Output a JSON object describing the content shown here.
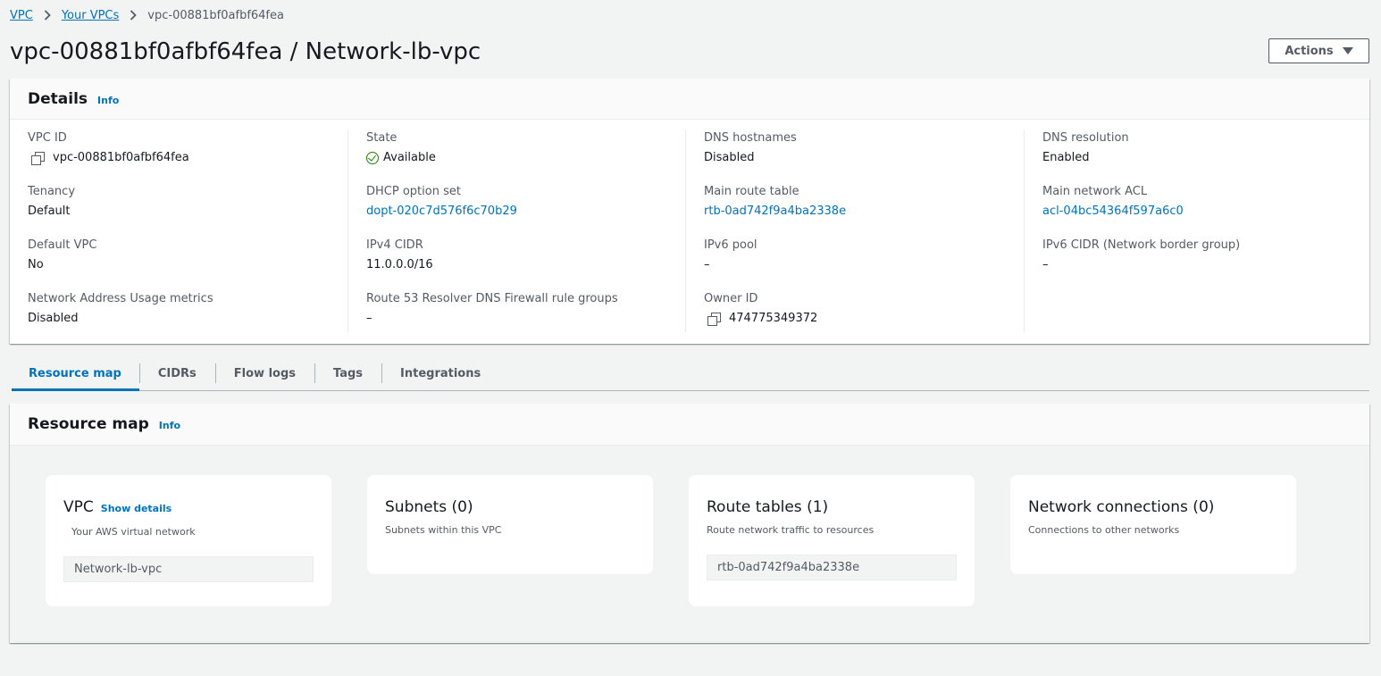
{
  "breadcrumb": {
    "items": [
      "VPC",
      "Your VPCs"
    ],
    "current": "vpc-00881bf0afbf64fea"
  },
  "header": {
    "title": "vpc-00881bf0afbf64fea / Network-lb-vpc",
    "actions_label": "Actions"
  },
  "details": {
    "title": "Details",
    "info": "Info",
    "columns": [
      [
        {
          "label": "VPC ID",
          "value": "vpc-00881bf0afbf64fea"
        },
        {
          "label": "Tenancy",
          "value": "Default"
        },
        {
          "label": "Default VPC",
          "value": "No"
        },
        {
          "label": "Network Address Usage metrics",
          "value": "Disabled"
        }
      ],
      [
        {
          "label": "State",
          "value": "Available"
        },
        {
          "label": "DHCP option set",
          "value": "dopt-020c7d576f6c70b29"
        },
        {
          "label": "IPv4 CIDR",
          "value": "11.0.0.0/16"
        },
        {
          "label": "Route 53 Resolver DNS Firewall rule groups",
          "value": "–"
        }
      ],
      [
        {
          "label": "DNS hostnames",
          "value": "Disabled"
        },
        {
          "label": "Main route table",
          "value": "rtb-0ad742f9a4ba2338e"
        },
        {
          "label": "IPv6 pool",
          "value": "–"
        },
        {
          "label": "Owner ID",
          "value": "474775349372"
        }
      ],
      [
        {
          "label": "DNS resolution",
          "value": "Enabled"
        },
        {
          "label": "Main network ACL",
          "value": "acl-04bc54364f597a6c0"
        },
        {
          "label": "IPv6 CIDR (Network border group)",
          "value": "–"
        }
      ]
    ],
    "status_color": "#1d8102",
    "link_color": "#0073bb"
  },
  "tabs": [
    "Resource map",
    "CIDRs",
    "Flow logs",
    "Tags",
    "Integrations"
  ],
  "active_tab": "Resource map",
  "resource_map": {
    "title": "Resource map",
    "info": "Info",
    "cards": [
      {
        "title": "VPC",
        "link": "Show details",
        "subtitle": "Your AWS virtual network",
        "item": "Network-lb-vpc"
      },
      {
        "title": "Subnets (0)",
        "subtitle": "Subnets within this VPC"
      },
      {
        "title": "Route tables (1)",
        "subtitle": "Route network traffic to resources",
        "item": "rtb-0ad742f9a4ba2338e"
      },
      {
        "title": "Network connections (0)",
        "subtitle": "Connections to other networks"
      }
    ]
  }
}
